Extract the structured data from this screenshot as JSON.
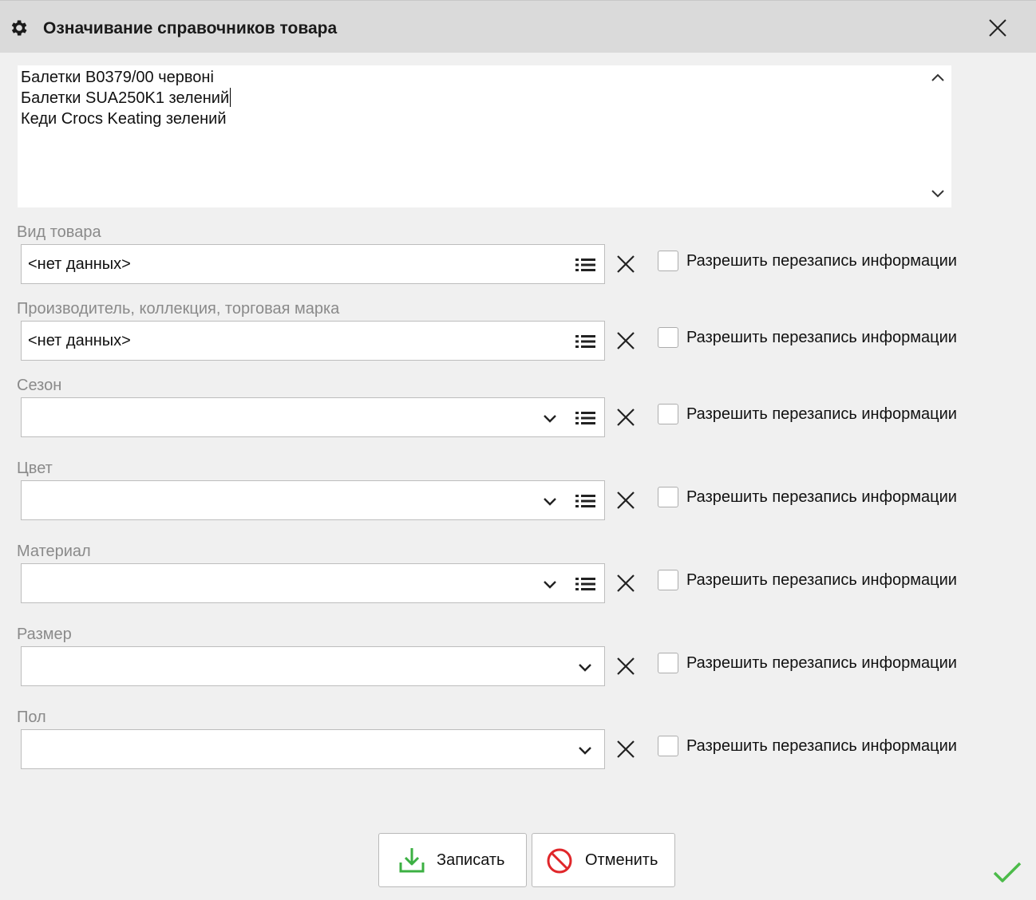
{
  "dialog": {
    "title": "Означивание справочников товара",
    "title_icon": "gear-icon",
    "close_icon": "close-icon"
  },
  "products_memo": {
    "lines": [
      "Балетки B0379/00 червоні",
      "Балетки SUA250K1 зелений",
      "Кеди Crocs Keating зелений"
    ]
  },
  "fields": [
    {
      "label": "Вид товара",
      "value": "<нет данных>",
      "has_dropdown": false,
      "has_list_button": true,
      "overwrite_checked": false
    },
    {
      "label": "Производитель, коллекция, торговая марка",
      "value": "<нет данных>",
      "has_dropdown": false,
      "has_list_button": true,
      "overwrite_checked": false
    },
    {
      "label": "Сезон",
      "value": "",
      "has_dropdown": true,
      "has_list_button": true,
      "overwrite_checked": false
    },
    {
      "label": "Цвет",
      "value": "",
      "has_dropdown": true,
      "has_list_button": true,
      "overwrite_checked": false
    },
    {
      "label": "Материал",
      "value": "",
      "has_dropdown": true,
      "has_list_button": true,
      "overwrite_checked": false
    },
    {
      "label": "Размер",
      "value": "",
      "has_dropdown": true,
      "has_list_button": false,
      "overwrite_checked": false
    },
    {
      "label": "Пол",
      "value": "",
      "has_dropdown": true,
      "has_list_button": false,
      "overwrite_checked": false
    }
  ],
  "overwrite_label": "Разрешить перезапись информации",
  "buttons": {
    "save_label": "Записать",
    "cancel_label": "Отменить"
  },
  "colors": {
    "save_icon": "#3cb043",
    "cancel_icon": "#e0262a",
    "status_check": "#4cbb4a"
  }
}
